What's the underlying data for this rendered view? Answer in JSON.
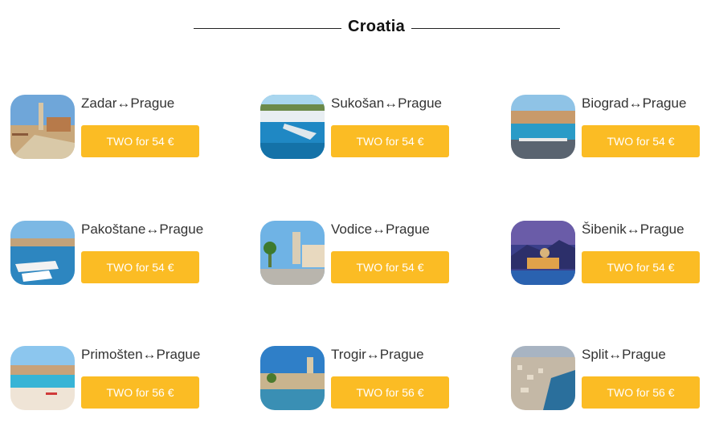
{
  "section": {
    "title": "Croatia"
  },
  "routes": [
    {
      "label": "Zadar↔Prague",
      "button": "TWO for 54 €",
      "thumb": "zadar-photo"
    },
    {
      "label": "Sukošan↔Prague",
      "button": "TWO for 54 €",
      "thumb": "sukosan-photo"
    },
    {
      "label": "Biograd↔Prague",
      "button": "TWO for 54 €",
      "thumb": "biograd-photo"
    },
    {
      "label": "Pakoštane↔Prague",
      "button": "TWO for 54 €",
      "thumb": "pakostane-photo"
    },
    {
      "label": "Vodice↔Prague",
      "button": "TWO for 54 €",
      "thumb": "vodice-photo"
    },
    {
      "label": "Šibenik↔Prague",
      "button": "TWO for 54 €",
      "thumb": "sibenik-photo"
    },
    {
      "label": "Primošten↔Prague",
      "button": "TWO for 56 €",
      "thumb": "primosten-photo"
    },
    {
      "label": "Trogir↔Prague",
      "button": "TWO for 56 €",
      "thumb": "trogir-photo"
    },
    {
      "label": "Split↔Prague",
      "button": "TWO for 56 €",
      "thumb": "split-photo"
    }
  ],
  "colors": {
    "button_bg": "#fbbc24",
    "button_text": "#ffffff",
    "text": "#333333"
  }
}
